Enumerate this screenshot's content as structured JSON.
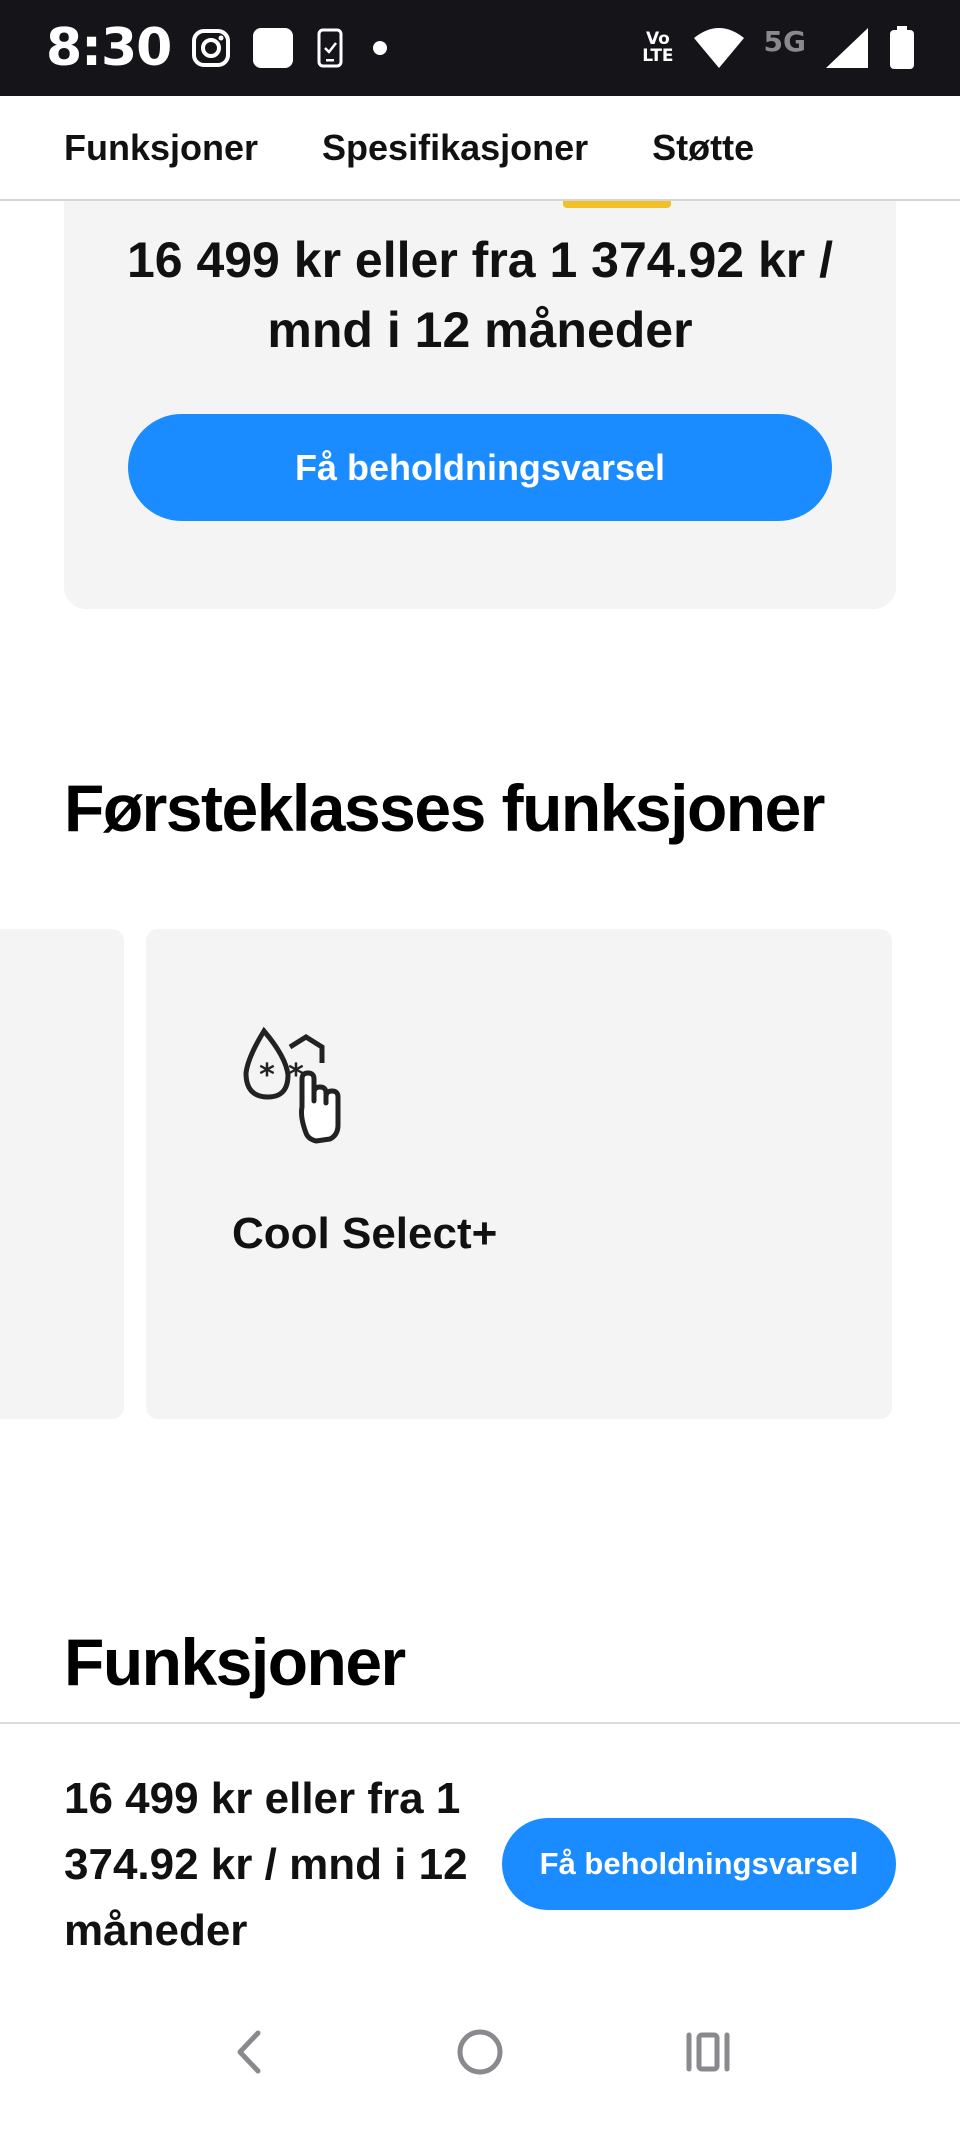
{
  "status_bar": {
    "time": "8:30",
    "volte_line1": "Vo",
    "volte_line2": "LTE",
    "network": "5G",
    "icons": [
      "instagram-icon",
      "app-square-icon",
      "phone-check-icon",
      "dot-icon",
      "wifi-icon",
      "signal-icon",
      "battery-icon"
    ]
  },
  "tabs": [
    {
      "label": "Funksjoner"
    },
    {
      "label": "Spesifikasjoner"
    },
    {
      "label": "Støtte"
    }
  ],
  "price_card": {
    "price_text": "16 499 kr eller fra 1 374.92 kr / mnd i 12 måneder",
    "button_label": "Få beholdningsvarsel"
  },
  "sections": {
    "premium_title": "Førsteklasses funksjoner",
    "features_title": "Funksjoner"
  },
  "feature_cards": [
    {
      "label": "Cool Select+",
      "icon": "cool-select-icon"
    }
  ],
  "sticky_bar": {
    "price_text": "16 499 kr eller fra 1 374.92 kr / mnd i 12 måneder",
    "button_label": "Få beholdningsvarsel"
  },
  "nav_bar": {
    "icons": [
      "back-icon",
      "home-icon",
      "recent-apps-icon"
    ]
  },
  "colors": {
    "accent": "#1a8cff",
    "status_bar_bg": "#141419",
    "card_bg": "#f4f4f4"
  }
}
